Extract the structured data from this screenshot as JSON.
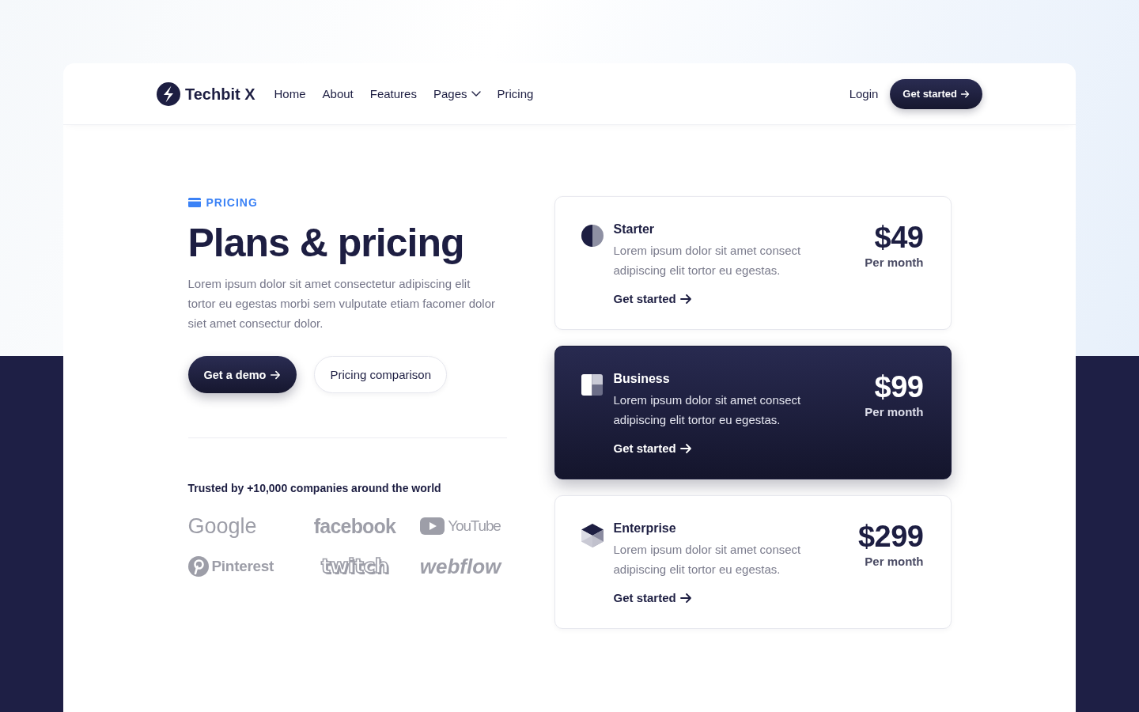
{
  "nav": {
    "brand": "Techbit X",
    "links": [
      {
        "label": "Home",
        "dropdown": false
      },
      {
        "label": "About",
        "dropdown": false
      },
      {
        "label": "Features",
        "dropdown": false
      },
      {
        "label": "Pages",
        "dropdown": true
      },
      {
        "label": "Pricing",
        "dropdown": false
      }
    ],
    "login": "Login",
    "cta": "Get started"
  },
  "hero": {
    "tag": "PRICING",
    "title": "Plans & pricing",
    "text": "Lorem ipsum dolor sit amet consectetur adipiscing elit tortor eu egestas morbi sem vulputate etiam facomer dolor siet amet consectur dolor.",
    "buttons": [
      {
        "label": "Get a demo",
        "kind": "primary"
      },
      {
        "label": "Pricing comparison",
        "kind": "secondary"
      }
    ]
  },
  "trusted": {
    "title": "Trusted by +10,000 companies around the world",
    "logos": [
      {
        "name": "Google",
        "kind": "light"
      },
      {
        "name": "facebook",
        "kind": "bold"
      },
      {
        "name": "YouTube",
        "kind": "play"
      },
      {
        "name": "Pinterest",
        "kind": "pin"
      },
      {
        "name": "twitch",
        "kind": "outline"
      },
      {
        "name": "webflow",
        "kind": "italic"
      }
    ]
  },
  "plans": [
    {
      "name": "Starter",
      "kind": "half-circle",
      "selected": false,
      "description": "Lorem ipsum dolor sit amet consect adipiscing elit tortor eu egestas.",
      "link": "Get started",
      "price": "$49",
      "period": "Per month"
    },
    {
      "name": "Business",
      "kind": "squares",
      "selected": true,
      "description": "Lorem ipsum dolor sit amet consect adipiscing elit tortor eu egestas.",
      "link": "Get started",
      "price": "$99",
      "period": "Per month"
    },
    {
      "name": "Enterprise",
      "kind": "cube",
      "selected": false,
      "description": "Lorem ipsum dolor sit amet consect adipiscing elit tortor eu egestas.",
      "link": "Get started",
      "price": "$299",
      "period": "Per month"
    }
  ]
}
